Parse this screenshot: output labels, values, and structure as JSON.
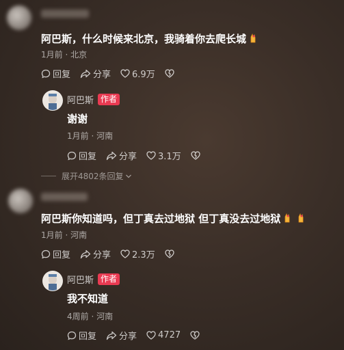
{
  "comment1": {
    "text": "阿巴斯，什么时候来北京，我骑着你去爬长城",
    "meta": "1月前 · 北京",
    "reply": "回复",
    "share": "分享",
    "likes": "6.9万",
    "author_reply": {
      "name": "阿巴斯",
      "badge": "作者",
      "text": "谢谢",
      "meta": "1月前 · 河南",
      "reply": "回复",
      "share": "分享",
      "likes": "3.1万"
    },
    "expand": "展开4802条回复"
  },
  "comment2": {
    "text": "阿巴斯你知道吗，但丁真去过地狱 但丁真没去过地狱",
    "meta": "1月前 · 河南",
    "reply": "回复",
    "share": "分享",
    "likes": "2.3万",
    "author_reply": {
      "name": "阿巴斯",
      "badge": "作者",
      "text": "我不知道",
      "meta": "4周前 · 河南",
      "reply": "回复",
      "share": "分享",
      "likes": "4727"
    }
  },
  "colors": {
    "badge": "#e93a52",
    "background": "#3a2e27"
  },
  "icons": [
    "comment-icon",
    "share-icon",
    "heart-icon",
    "dislike-icon",
    "fingers-crossed-emoji",
    "chevron-down-icon"
  ]
}
